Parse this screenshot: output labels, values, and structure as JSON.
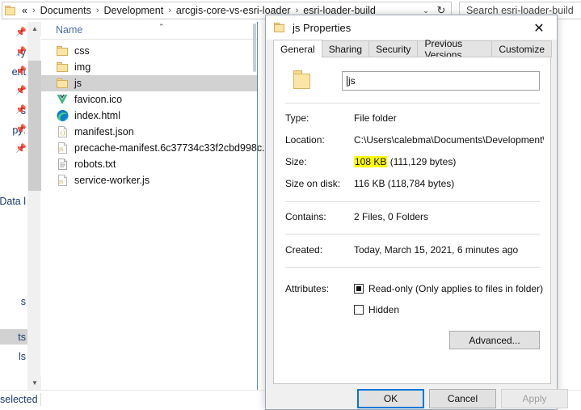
{
  "explorer": {
    "address": {
      "prefix": "«",
      "crumbs": [
        "Documents",
        "Development",
        "arcgis-core-vs-esri-loader",
        "esri-loader-build"
      ],
      "separator": "›",
      "dropdown_glyph": "⌄",
      "refresh_glyph": "↻"
    },
    "search": {
      "placeholder": "Search esri-loader-build"
    },
    "nav_pane_items": [
      {
        "label": "",
        "pinned": true
      },
      {
        "label": "ry",
        "pinned": true
      },
      {
        "label": "ent",
        "pinned": true
      },
      {
        "label": "",
        "pinned": true
      },
      {
        "label": "s",
        "pinned": true
      },
      {
        "label": "py:",
        "pinned": true
      },
      {
        "label": "",
        "pinned": true
      },
      {
        "label": "Data l",
        "pinned": false
      },
      {
        "label": "s",
        "pinned": false
      },
      {
        "label": "ts",
        "pinned": false,
        "selected": true
      },
      {
        "label": "ls",
        "pinned": false
      }
    ],
    "column_header": {
      "name": "Name",
      "sort_glyph": "⌃"
    },
    "files": [
      {
        "name": "css",
        "icon": "folder-icon",
        "selected": false
      },
      {
        "name": "img",
        "icon": "folder-icon",
        "selected": false
      },
      {
        "name": "js",
        "icon": "folder-icon",
        "selected": true
      },
      {
        "name": "favicon.ico",
        "icon": "vue-file-icon",
        "selected": false
      },
      {
        "name": "index.html",
        "icon": "edge-file-icon",
        "selected": false
      },
      {
        "name": "manifest.json",
        "icon": "json-file-icon",
        "selected": false
      },
      {
        "name": "precache-manifest.6c37734c33f2cbd998c...",
        "icon": "js-file-icon",
        "selected": false
      },
      {
        "name": "robots.txt",
        "icon": "text-file-icon",
        "selected": false
      },
      {
        "name": "service-worker.js",
        "icon": "js-file-icon",
        "selected": false
      }
    ],
    "status": {
      "text": "selected"
    }
  },
  "dialog": {
    "title": "js Properties",
    "close_glyph": "✕",
    "tabs": [
      {
        "label": "General",
        "active": true
      },
      {
        "label": "Sharing",
        "active": false
      },
      {
        "label": "Security",
        "active": false
      },
      {
        "label": "Previous Versions",
        "active": false
      },
      {
        "label": "Customize",
        "active": false
      }
    ],
    "name_value": "js",
    "properties": [
      {
        "label": "Type:",
        "value": "File folder"
      },
      {
        "label": "Location:",
        "value": "C:\\Users\\calebma\\Documents\\Development\\arcgis"
      },
      {
        "label": "Size:",
        "value_highlight": "108 KB",
        "value_rest": " (111,129 bytes)"
      },
      {
        "label": "Size on disk:",
        "value": "116 KB (118,784 bytes)"
      },
      {
        "label": "Contains:",
        "value": "2 Files, 0 Folders"
      },
      {
        "label": "Created:",
        "value": "Today, March 15, 2021, 6 minutes ago"
      }
    ],
    "attributes_label": "Attributes:",
    "attributes": [
      {
        "label": "Read-only (Only applies to files in folder)",
        "state": "indeterminate"
      },
      {
        "label": "Hidden",
        "state": "unchecked"
      }
    ],
    "advanced_button": "Advanced...",
    "buttons": {
      "ok": "OK",
      "cancel": "Cancel",
      "apply": "Apply"
    }
  },
  "colors": {
    "highlight": "#ffff00",
    "selection": "#d2d2d2",
    "focus_blue": "#0078d7"
  }
}
